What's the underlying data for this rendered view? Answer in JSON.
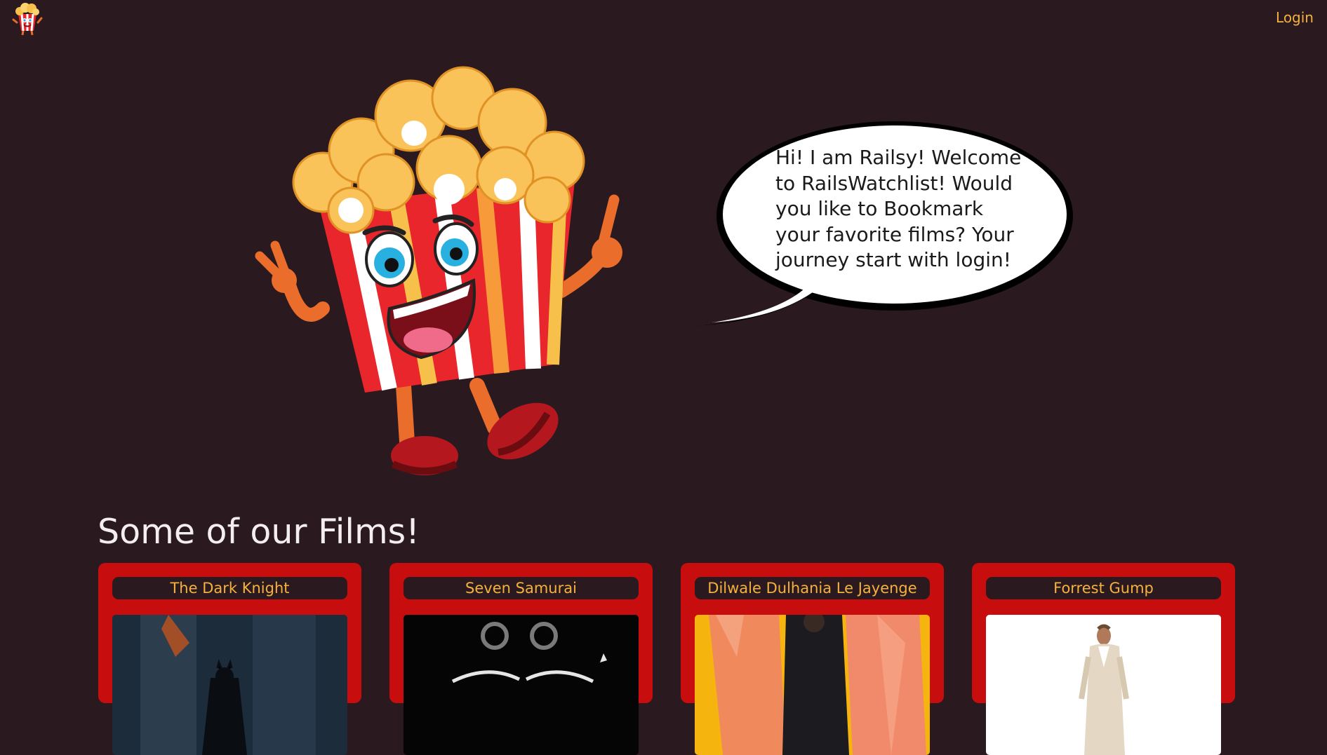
{
  "nav": {
    "logo_icon": "popcorn-mascot-logo-icon",
    "login_label": "Login"
  },
  "hero": {
    "mascot_icon": "popcorn-mascot-thumbs-up",
    "speech": "Hi! I am Railsy! Welcome to RailsWatchlist! Would you like to Bookmark your favorite films? Your journey start with login!"
  },
  "films_section": {
    "title": "Some of our Films!",
    "films": [
      {
        "title": "The Dark Knight",
        "poster_icon": "dark-knight-poster"
      },
      {
        "title": "Seven Samurai",
        "poster_icon": "seven-samurai-poster"
      },
      {
        "title": "Dilwale Dulhania Le Jayenge",
        "poster_icon": "ddlj-poster"
      },
      {
        "title": "Forrest Gump",
        "poster_icon": "forrest-gump-poster"
      }
    ]
  },
  "colors": {
    "background": "#2a1a1f",
    "accent": "#f4b13e",
    "card": "#c70d0d",
    "text_light": "#f4eef0"
  }
}
